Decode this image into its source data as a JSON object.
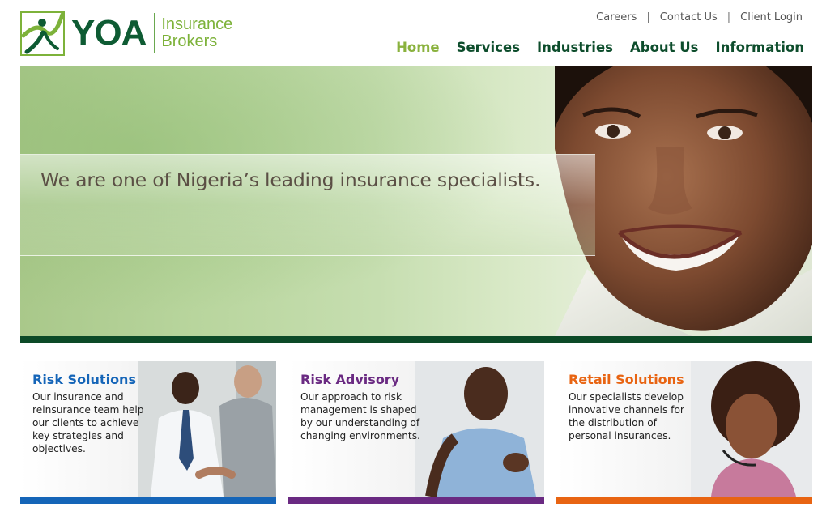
{
  "brand": {
    "name": "YOA",
    "subtitle_line1": "Insurance",
    "subtitle_line2": "Brokers"
  },
  "utility_nav": [
    "Careers",
    "Contact Us",
    "Client Login"
  ],
  "main_nav": [
    {
      "label": "Home",
      "active": true
    },
    {
      "label": "Services",
      "active": false
    },
    {
      "label": "Industries",
      "active": false
    },
    {
      "label": "About Us",
      "active": false
    },
    {
      "label": "Information",
      "active": false
    }
  ],
  "hero": {
    "tagline": "We are one of Nigeria’s leading insurance specialists."
  },
  "cards": [
    {
      "title": "Risk Solutions",
      "description": "Our insurance and reinsurance team help our clients to achieve key strategies and objectives.",
      "accent": "#1565b8"
    },
    {
      "title": "Risk Advisory",
      "description": "Our approach to risk management is shaped by our understanding of changing environments.",
      "accent": "#6a2a82"
    },
    {
      "title": "Retail Solutions",
      "description": "Our specialists develop innovative channels for the distribution of personal insurances.",
      "accent": "#e86412"
    }
  ],
  "colors": {
    "brand_dark_green": "#0e5b33",
    "brand_light_green": "#7db23a",
    "nav_active": "#8ab23e",
    "hero_bar": "#0c4a27"
  }
}
